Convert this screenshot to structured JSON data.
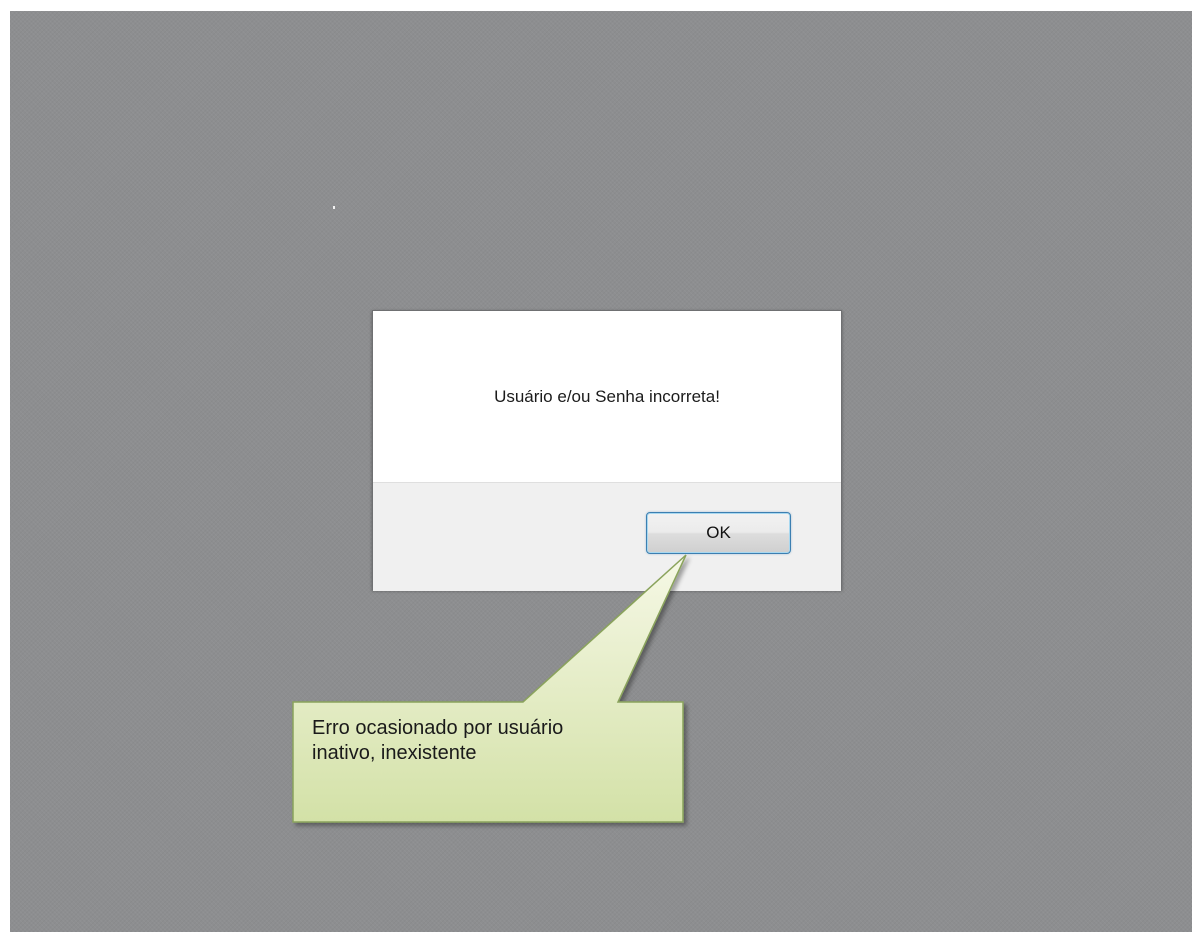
{
  "dialog": {
    "message": "Usuário e/ou Senha incorreta!",
    "ok_label": "OK"
  },
  "callout": {
    "line1": "Erro ocasionado por usuário",
    "line2": "inativo, inexistente"
  },
  "colors": {
    "overlay": "#8d8e90",
    "dialog_body": "#ffffff",
    "dialog_footer": "#f0f0f0",
    "button_border": "#3c7fb1",
    "callout_fill_light": "#f6f8e6",
    "callout_fill_dark": "#d3e1a7",
    "callout_border": "#8aa35c"
  }
}
